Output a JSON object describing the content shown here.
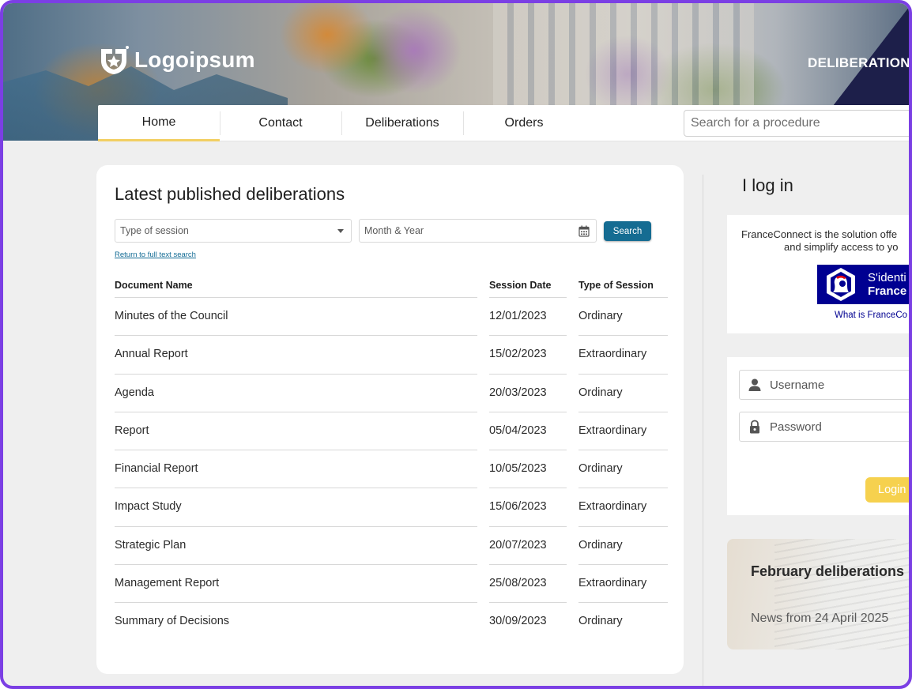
{
  "header": {
    "logo_text": "Logoipsum",
    "title": "DELIBERATIONS"
  },
  "nav": {
    "tabs": [
      {
        "label": "Home",
        "active": true
      },
      {
        "label": "Contact",
        "active": false
      },
      {
        "label": "Deliberations",
        "active": false
      },
      {
        "label": "Orders",
        "active": false
      }
    ],
    "search_placeholder": "Search for a procedure"
  },
  "main": {
    "title": "Latest published deliberations",
    "filters": {
      "session_placeholder": "Type of session",
      "date_placeholder": "Month & Year",
      "search_label": "Search",
      "fulltext_link": "Return to full text search"
    },
    "table": {
      "columns": [
        "Document Name",
        "Session Date",
        "Type of Session"
      ],
      "rows": [
        [
          "Minutes of the Council",
          "12/01/2023",
          "Ordinary"
        ],
        [
          "Annual Report",
          "15/02/2023",
          "Extraordinary"
        ],
        [
          "Agenda",
          "20/03/2023",
          "Ordinary"
        ],
        [
          "Report",
          "05/04/2023",
          "Extraordinary"
        ],
        [
          "Financial Report",
          "10/05/2023",
          "Ordinary"
        ],
        [
          "Impact Study",
          "15/06/2023",
          "Extraordinary"
        ],
        [
          "Strategic Plan",
          "20/07/2023",
          "Ordinary"
        ],
        [
          "Management Report",
          "25/08/2023",
          "Extraordinary"
        ],
        [
          "Summary of Decisions",
          "30/09/2023",
          "Ordinary"
        ]
      ]
    }
  },
  "sidebar": {
    "login_title": "I log in",
    "franceconnect": {
      "text_line1": "FranceConnect is the solution offe",
      "text_line2": "and simplify access to yo",
      "button_line1": "S'identi",
      "button_line2": "France",
      "what_link": "What is FranceCo"
    },
    "login": {
      "username_placeholder": "Username",
      "password_placeholder": "Password",
      "button_label": "Login"
    },
    "news": {
      "title": "February deliberations",
      "date": "News from 24 April 2025"
    }
  },
  "colors": {
    "frame_border": "#7b3fe4",
    "search_button": "#156c92",
    "active_tab_underline": "#f2cf63",
    "login_button": "#f6d14e",
    "franceconnect_blue": "#000091"
  }
}
